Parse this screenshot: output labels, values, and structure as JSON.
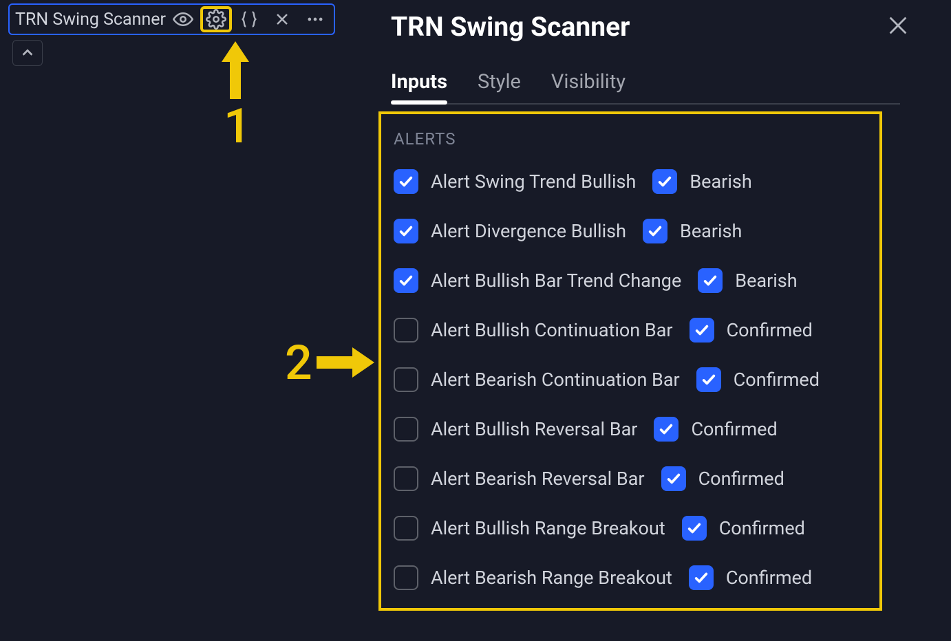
{
  "chip": {
    "title": "TRN Swing Scanner"
  },
  "annotations": {
    "n1": "1",
    "n2": "2"
  },
  "panel": {
    "title": "TRN Swing Scanner",
    "tabs": {
      "inputs": "Inputs",
      "style": "Style",
      "visibility": "Visibility"
    },
    "section": "ALERTS",
    "rows": [
      {
        "l1": "Alert Swing Trend Bullish",
        "c1": true,
        "l2": "Bearish",
        "c2": true
      },
      {
        "l1": "Alert Divergence Bullish",
        "c1": true,
        "l2": "Bearish",
        "c2": true
      },
      {
        "l1": "Alert Bullish Bar Trend Change",
        "c1": true,
        "l2": "Bearish",
        "c2": true
      },
      {
        "l1": "Alert Bullish Continuation Bar",
        "c1": false,
        "l2": "Confirmed",
        "c2": true
      },
      {
        "l1": "Alert Bearish Continuation Bar",
        "c1": false,
        "l2": "Confirmed",
        "c2": true
      },
      {
        "l1": "Alert Bullish Reversal Bar",
        "c1": false,
        "l2": "Confirmed",
        "c2": true
      },
      {
        "l1": "Alert Bearish Reversal Bar",
        "c1": false,
        "l2": "Confirmed",
        "c2": true
      },
      {
        "l1": "Alert Bullish Range Breakout",
        "c1": false,
        "l2": "Confirmed",
        "c2": true
      },
      {
        "l1": "Alert Bearish Range Breakout",
        "c1": false,
        "l2": "Confirmed",
        "c2": true
      }
    ]
  }
}
